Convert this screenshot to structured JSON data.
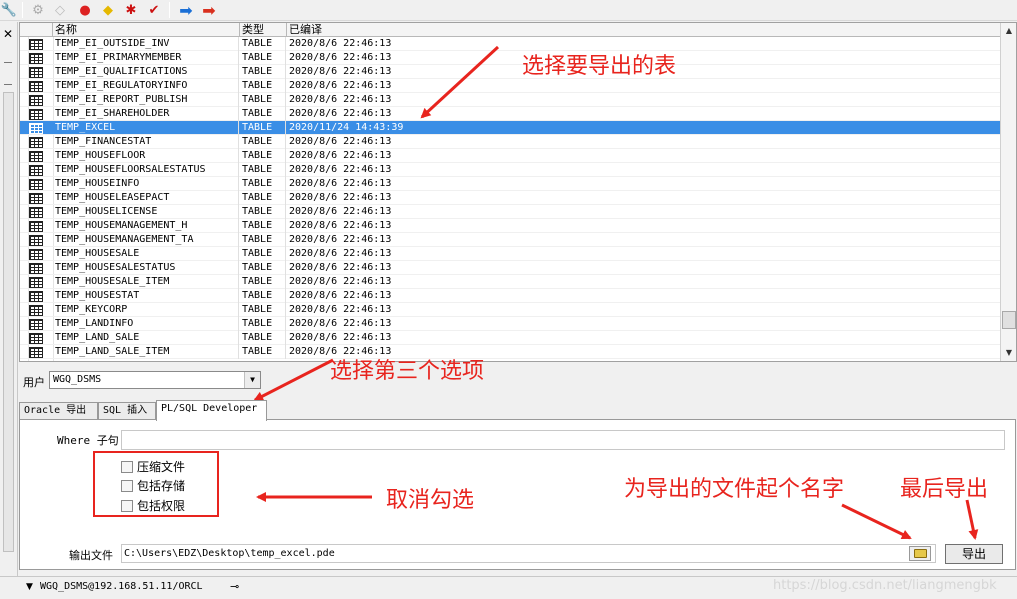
{
  "toolbar": {
    "icons": [
      "wrench-icon",
      "copy-gray-icon",
      "eraser-icon",
      "red-db-icon",
      "yellow-red-icon",
      "red-gear-icon",
      "red-check-icon",
      "arrow-right-blue-icon",
      "arrow-right-red-icon"
    ]
  },
  "table": {
    "headers": {
      "name": "名称",
      "type": "类型",
      "compiled": "已编译"
    },
    "rows": [
      {
        "name": "TEMP_EI_OUTSIDE_INV",
        "type": "TABLE",
        "date": "2020/8/6 22:46:13"
      },
      {
        "name": "TEMP_EI_PRIMARYMEMBER",
        "type": "TABLE",
        "date": "2020/8/6 22:46:13"
      },
      {
        "name": "TEMP_EI_QUALIFICATIONS",
        "type": "TABLE",
        "date": "2020/8/6 22:46:13"
      },
      {
        "name": "TEMP_EI_REGULATORYINFO",
        "type": "TABLE",
        "date": "2020/8/6 22:46:13"
      },
      {
        "name": "TEMP_EI_REPORT_PUBLISH",
        "type": "TABLE",
        "date": "2020/8/6 22:46:13"
      },
      {
        "name": "TEMP_EI_SHAREHOLDER",
        "type": "TABLE",
        "date": "2020/8/6 22:46:13"
      },
      {
        "name": "TEMP_EXCEL",
        "type": "TABLE",
        "date": "2020/11/24 14:43:39",
        "selected": true
      },
      {
        "name": "TEMP_FINANCESTAT",
        "type": "TABLE",
        "date": "2020/8/6 22:46:13"
      },
      {
        "name": "TEMP_HOUSEFLOOR",
        "type": "TABLE",
        "date": "2020/8/6 22:46:13"
      },
      {
        "name": "TEMP_HOUSEFLOORSALESTATUS",
        "type": "TABLE",
        "date": "2020/8/6 22:46:13"
      },
      {
        "name": "TEMP_HOUSEINFO",
        "type": "TABLE",
        "date": "2020/8/6 22:46:13"
      },
      {
        "name": "TEMP_HOUSELEASEPACT",
        "type": "TABLE",
        "date": "2020/8/6 22:46:13"
      },
      {
        "name": "TEMP_HOUSELICENSE",
        "type": "TABLE",
        "date": "2020/8/6 22:46:13"
      },
      {
        "name": "TEMP_HOUSEMANAGEMENT_H",
        "type": "TABLE",
        "date": "2020/8/6 22:46:13"
      },
      {
        "name": "TEMP_HOUSEMANAGEMENT_TA",
        "type": "TABLE",
        "date": "2020/8/6 22:46:13"
      },
      {
        "name": "TEMP_HOUSESALE",
        "type": "TABLE",
        "date": "2020/8/6 22:46:13"
      },
      {
        "name": "TEMP_HOUSESALESTATUS",
        "type": "TABLE",
        "date": "2020/8/6 22:46:13"
      },
      {
        "name": "TEMP_HOUSESALE_ITEM",
        "type": "TABLE",
        "date": "2020/8/6 22:46:13"
      },
      {
        "name": "TEMP_HOUSESTAT",
        "type": "TABLE",
        "date": "2020/8/6 22:46:13"
      },
      {
        "name": "TEMP_KEYCORP",
        "type": "TABLE",
        "date": "2020/8/6 22:46:13"
      },
      {
        "name": "TEMP_LANDINFO",
        "type": "TABLE",
        "date": "2020/8/6 22:46:13"
      },
      {
        "name": "TEMP_LAND_SALE",
        "type": "TABLE",
        "date": "2020/8/6 22:46:13"
      },
      {
        "name": "TEMP_LAND_SALE_ITEM",
        "type": "TABLE",
        "date": "2020/8/6 22:46:13"
      }
    ]
  },
  "user": {
    "label": "用户",
    "value": "WGQ_DSMS"
  },
  "tabs": [
    {
      "label": "Oracle 导出",
      "active": false
    },
    {
      "label": "SQL 插入",
      "active": false
    },
    {
      "label": "PL/SQL Developer",
      "active": true
    }
  ],
  "panel": {
    "where_label": "Where 子句",
    "where_value": "",
    "checkboxes": [
      {
        "label": "压缩文件",
        "checked": false
      },
      {
        "label": "包括存储",
        "checked": false
      },
      {
        "label": "包括权限",
        "checked": false
      }
    ],
    "output_label": "输出文件",
    "output_value": "C:\\Users\\EDZ\\Desktop\\temp_excel.pde",
    "export_button": "导出"
  },
  "status": {
    "connection": "WGQ_DSMS@192.168.51.11/ORCL"
  },
  "watermark": "https://blog.csdn.net/liangmengbk",
  "annotations": {
    "select_table": "选择要导出的表",
    "select_third": "选择第三个选项",
    "uncheck": "取消勾选",
    "name_file": "为导出的文件起个名字",
    "finally_export": "最后导出",
    "color": "#e8241e"
  },
  "colors": {
    "selection": "#3a8ee6",
    "annotation": "#e8241e"
  }
}
